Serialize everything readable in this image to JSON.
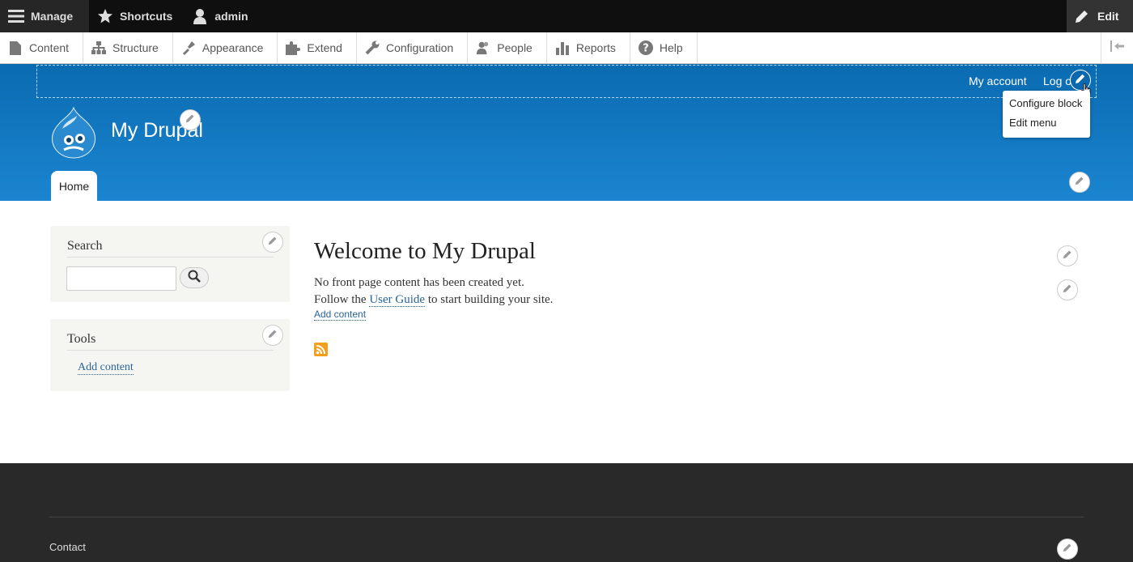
{
  "toolbar": {
    "manage": "Manage",
    "shortcuts": "Shortcuts",
    "user": "admin",
    "edit": "Edit"
  },
  "tray": {
    "items": [
      "Content",
      "Structure",
      "Appearance",
      "Extend",
      "Configuration",
      "People",
      "Reports",
      "Help"
    ]
  },
  "header": {
    "my_account": "My account",
    "log_out": "Log o",
    "site_name": "My Drupal",
    "home_tab": "Home"
  },
  "contextual": {
    "configure_block": "Configure block",
    "edit_menu": "Edit menu"
  },
  "sidebar": {
    "search_title": "Search",
    "tools_title": "Tools",
    "add_content": "Add content"
  },
  "main": {
    "title": "Welcome to My Drupal",
    "line1": "No front page content has been created yet.",
    "line2_before": "Follow the ",
    "user_guide": "User Guide",
    "line2_after": " to start building your site.",
    "add_content": "Add content"
  },
  "footer": {
    "contact": "Contact"
  },
  "colors": {
    "header_top": "#0a6bb1",
    "header_bottom": "#1b85d0",
    "toolbar": "#0f0f0f",
    "link": "#2a6496",
    "rss": "#f39f1b"
  }
}
